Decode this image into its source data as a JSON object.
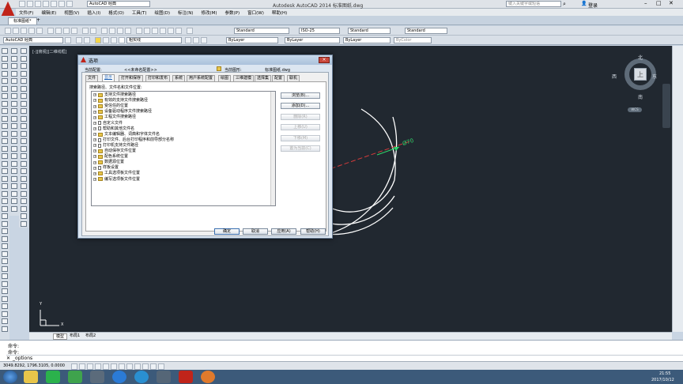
{
  "window": {
    "title": "Autodesk AutoCAD 2014    标准图纸.dwg",
    "workspace": "AutoCAD 经典",
    "search_placeholder": "键入关键字或短语",
    "login": "登录"
  },
  "menu": [
    "文件(F)",
    "编辑(E)",
    "视图(V)",
    "插入(I)",
    "格式(O)",
    "工具(T)",
    "绘图(D)",
    "标注(N)",
    "修改(M)",
    "参数(P)",
    "窗口(W)",
    "帮助(H)"
  ],
  "doc_tab": "标准图纸*",
  "toolbar1": {
    "style1": "Standard",
    "style2": "ISO-25",
    "style3": "Standard",
    "style4": "Standard"
  },
  "toolbar2": {
    "workspace": "AutoCAD 经典",
    "layer": "粗实线",
    "color": "ByLayer",
    "linetype": "ByLayer",
    "lineweight": "ByLayer",
    "plotstyle": "ByColor"
  },
  "viewport_label": "[-][俯视][二维线框]",
  "viewcube": {
    "north": "北",
    "south": "南",
    "east": "东",
    "west": "西",
    "top": "上",
    "wcs": "WCS"
  },
  "dimension": "Ø70",
  "ucs": {
    "x": "X",
    "y": "Y"
  },
  "layout_tabs": [
    "模型",
    "布局1",
    "布局2"
  ],
  "command": {
    "line1": "命令:",
    "line2": "命令:",
    "prompt": "_options"
  },
  "status": {
    "coords": "3049.8292, 1796.3105, 0.0000"
  },
  "clock": {
    "time": "21:55",
    "date": "2017/10/12"
  },
  "dialog": {
    "title": "选项",
    "profile_label": "当前配置:",
    "profile_value": "<<未命名配置>>",
    "drawing_label": "当前图形:",
    "drawing_value": "标准图纸.dwg",
    "tabs": [
      "文件",
      "显示",
      "打开和保存",
      "打印和发布",
      "系统",
      "用户系统配置",
      "绘图",
      "三维建模",
      "选择集",
      "配置",
      "联机"
    ],
    "search_label": "搜索路径、文件名和文件位置:",
    "tree": [
      "支持文件搜索路径",
      "有效的支持文件搜索路径",
      "受信任的位置",
      "设备驱动程序文件搜索路径",
      "工程文件搜索路径",
      "自定义文件",
      "帮助和其他文件名",
      "文本编辑器、词典和字体文件名",
      "打印文件、后台打印程序和前导部分名称",
      "打印机支持文件路径",
      "自动保存文件位置",
      "配色系统位置",
      "数据源位置",
      "样板设置",
      "工具选项板文件位置",
      "编写选项板文件位置"
    ],
    "side_buttons": [
      "浏览(B)...",
      "添加(D)...",
      "删除(R)",
      "上移(U)",
      "下移(M)",
      "置为当前(C)"
    ],
    "footer_buttons": [
      "确定",
      "取消",
      "应用(A)",
      "帮助(H)"
    ]
  }
}
